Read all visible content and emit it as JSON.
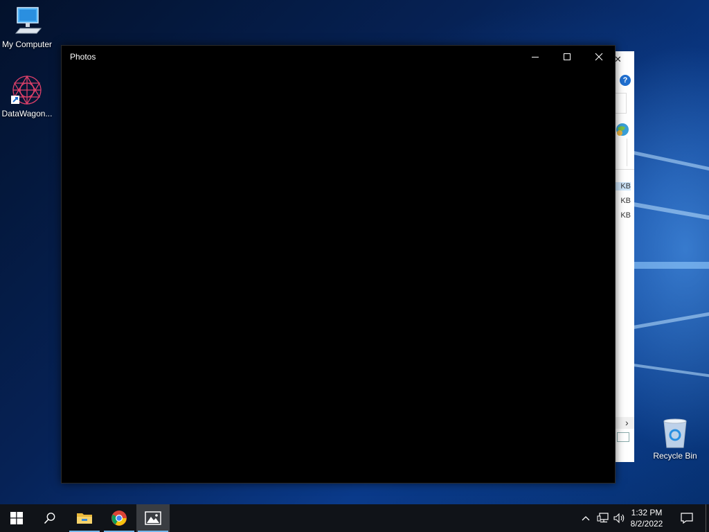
{
  "desktop": {
    "icons": [
      {
        "label": "My Computer",
        "icon": "computer-icon"
      },
      {
        "label": "DataWagon...",
        "icon": "datawagon-icon"
      },
      {
        "label": "Recycle Bin",
        "icon": "recycle-bin-icon"
      }
    ]
  },
  "background_window": {
    "close_glyph": "✕",
    "help_glyph": "?",
    "rows": [
      "KB",
      "KB",
      "KB"
    ],
    "scroll_glyph": "›"
  },
  "photos_window": {
    "title": "Photos",
    "buttons": [
      "minimize",
      "maximize",
      "close"
    ]
  },
  "taskbar": {
    "items": [
      "start-button",
      "search-button",
      "file-explorer",
      "chrome",
      "photos"
    ],
    "active_item": "photos",
    "tray": {
      "time": "1:32 PM",
      "date": "8/2/2022",
      "icons": [
        "chevron-up-icon",
        "network-icon",
        "volume-icon",
        "notification-icon"
      ]
    }
  },
  "colors": {
    "taskbar": "#101318",
    "accent": "#76b9ed",
    "window_bg": "#000000"
  }
}
